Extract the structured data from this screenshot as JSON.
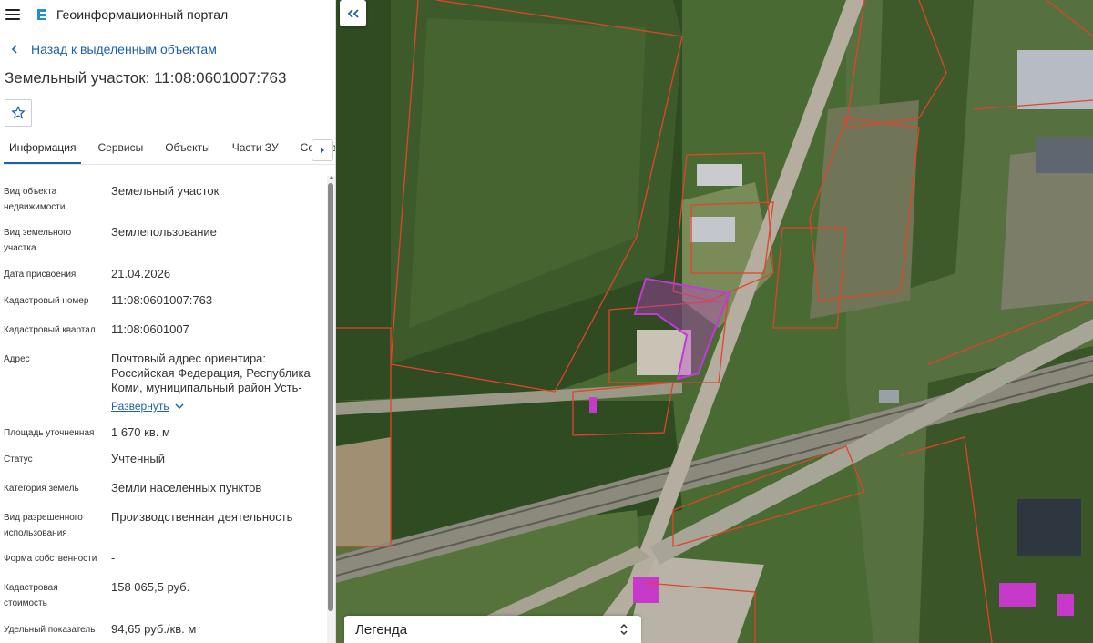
{
  "app": {
    "title": "Геоинформационный портал"
  },
  "nav": {
    "back_label": "Назад к выделенным объектам"
  },
  "object": {
    "title": "Земельный участок: 11:08:0601007:763"
  },
  "tabs": [
    {
      "label": "Информация",
      "active": true
    },
    {
      "label": "Сервисы"
    },
    {
      "label": "Объекты"
    },
    {
      "label": "Части ЗУ"
    },
    {
      "label": "Состав"
    }
  ],
  "props": [
    {
      "label": "Вид объекта недвижимости",
      "value": "Земельный участок"
    },
    {
      "label": "Вид земельного участка",
      "value": "Землепользование"
    },
    {
      "label": "Дата присвоения",
      "value": "21.04.2026"
    },
    {
      "label": "Кадастровый номер",
      "value": "11:08:0601007:763"
    },
    {
      "label": "Кадастровый квартал",
      "value": "11:08:0601007"
    },
    {
      "label": "Адрес",
      "value": "Почтовый адрес ориентира: Российская Федерация, Республика Коми, муниципальный район Усть-"
    },
    {
      "label": "Площадь уточненная",
      "value": "1 670 кв. м"
    },
    {
      "label": "Статус",
      "value": "Учтенный"
    },
    {
      "label": "Категория земель",
      "value": "Земли населенных пунктов"
    },
    {
      "label": "Вид разрешенного использования",
      "value": "Производственная деятельность"
    },
    {
      "label": "Форма собственности",
      "value": "-"
    },
    {
      "label": "Кадастровая стоимость",
      "value": "158 065,5 руб."
    },
    {
      "label": "Удельный показатель",
      "value": "94,65 руб./кв. м"
    }
  ],
  "address_expand_label": "Развернуть",
  "legend": {
    "title": "Легенда"
  },
  "colors": {
    "accent": "#1f5fa7",
    "parcel_border": "#e0442a",
    "selected_parcel": "#c23ad6"
  },
  "icons": {
    "menu": "hamburger-icon",
    "logo": "portal-logo-icon",
    "back": "chevron-left-icon",
    "favorite": "star-icon",
    "tabs_next": "chevron-right-icon",
    "collapse": "double-chevron-left-icon",
    "legend_toggle": "up-down-chevron-icon"
  }
}
